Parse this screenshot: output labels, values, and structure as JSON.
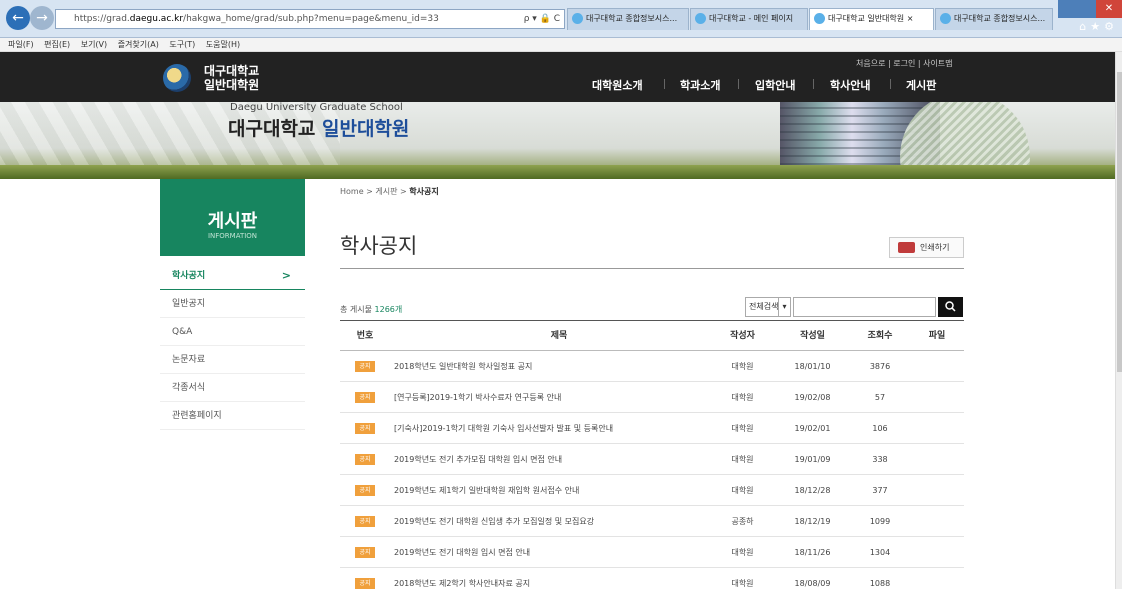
{
  "browser": {
    "url_prefix": "https://grad.",
    "url_host": "daegu.ac.kr",
    "url_path": "/hakgwa_home/grad/sub.php?menu=page&menu_id=33",
    "addr_icons": "ρ ▾ 🔒 C",
    "tabs": [
      "대구대학교 종합정보시스...",
      "대구대학교 - 메인 페이지",
      "대구대학교 일반대학원",
      "대구대학교 종합정보시스..."
    ],
    "active_tab_close": "×",
    "menu": [
      "파일(F)",
      "편집(E)",
      "보기(V)",
      "즐겨찾기(A)",
      "도구(T)",
      "도움말(H)"
    ]
  },
  "header": {
    "logo_line1": "대구대학교",
    "logo_line2": "일반대학원",
    "util": "처음으로 | 로그인 | 사이트맵",
    "nav": [
      "대학원소개",
      "학과소개",
      "입학안내",
      "학사안내",
      "게시판"
    ]
  },
  "banner": {
    "english": "Daegu University Graduate School",
    "title_main": "대구대학교 ",
    "title_accent": "일반대학원"
  },
  "sidebar": {
    "title": "게시판",
    "subtitle": "INFORMATION",
    "items": [
      {
        "label": "학사공지",
        "active": true,
        "chevron": ">"
      },
      {
        "label": "일반공지"
      },
      {
        "label": "Q&A"
      },
      {
        "label": "논문자료"
      },
      {
        "label": "각종서식"
      },
      {
        "label": "관련홈페이지"
      }
    ]
  },
  "content": {
    "breadcrumb_pre": "Home > 게시판 > ",
    "breadcrumb_current": "학사공지",
    "page_title": "학사공지",
    "print_label": "인쇄하기",
    "total_label": "총 게시물 ",
    "total_count": "1266개",
    "search_select": "전체검색",
    "search_placeholder": ""
  },
  "table": {
    "headers": [
      "번호",
      "제목",
      "작성자",
      "작성일",
      "조회수",
      "파일"
    ],
    "badge": "공지",
    "rows": [
      {
        "title": "2018학년도 일반대학원 학사일정표 공지",
        "author": "대학원",
        "date": "18/01/10",
        "views": "3876"
      },
      {
        "title": "[연구등록]2019-1학기 박사수료자 연구등록 안내",
        "author": "대학원",
        "date": "19/02/08",
        "views": "57"
      },
      {
        "title": "[기숙사]2019-1학기 대학원 기숙사 입사선발자 발표 및 등록안내",
        "author": "대학원",
        "date": "19/02/01",
        "views": "106"
      },
      {
        "title": "2019학년도 전기 추가모집 대학원 입시 면접 안내",
        "author": "대학원",
        "date": "19/01/09",
        "views": "338"
      },
      {
        "title": "2019학년도 제1학기 일반대학원 재입학 원서접수 안내",
        "author": "대학원",
        "date": "18/12/28",
        "views": "377"
      },
      {
        "title": "2019학년도 전기 대학원 신입생 추가 모집일정 및 모집요강",
        "author": "공종하",
        "date": "18/12/19",
        "views": "1099"
      },
      {
        "title": "2019학년도 전기 대학원 입시 면접 안내",
        "author": "대학원",
        "date": "18/11/26",
        "views": "1304"
      },
      {
        "title": "2018학년도 제2학기 학사안내자료 공지",
        "author": "대학원",
        "date": "18/08/09",
        "views": "1088"
      }
    ]
  }
}
